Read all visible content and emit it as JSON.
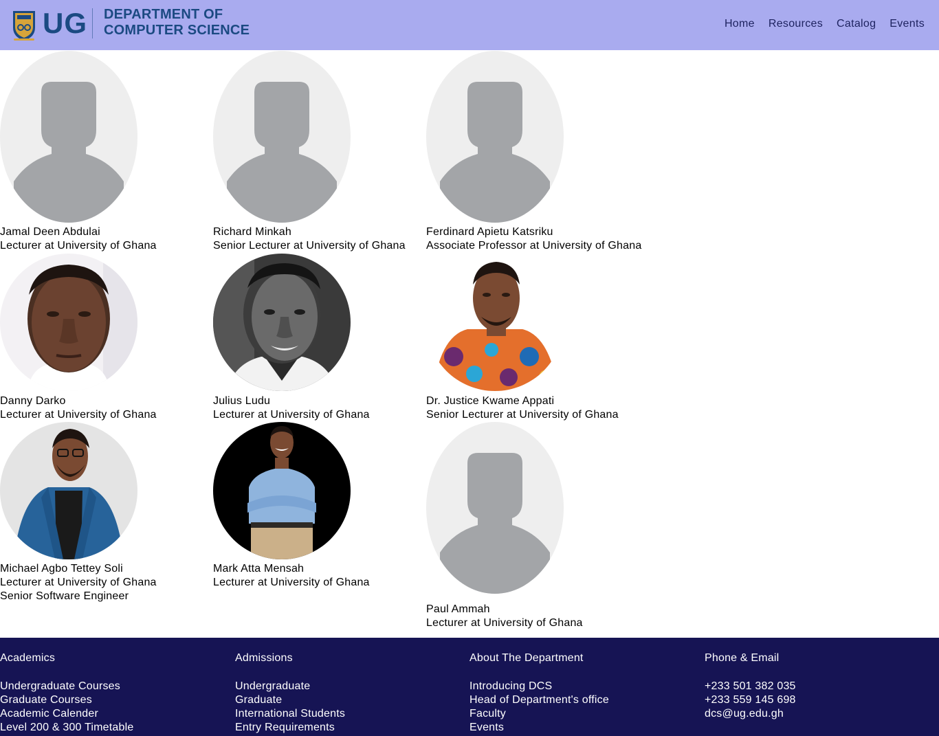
{
  "header": {
    "logo_text": "UG",
    "dept_line1": "DEPARTMENT OF",
    "dept_line2": "COMPUTER SCIENCE",
    "nav": [
      "Home",
      "Resources",
      "Catalog",
      "Events"
    ]
  },
  "faculty": [
    {
      "name": "Jamal Deen Abdulai",
      "role": "Lecturer at University of Ghana",
      "photo": "placeholder-avatar"
    },
    {
      "name": "Richard Minkah",
      "role": "Senior Lecturer at University of Ghana",
      "photo": "placeholder-avatar"
    },
    {
      "name": "Ferdinard Apietu Katsriku",
      "role": "Associate Professor at University of Ghana",
      "photo": "placeholder-avatar"
    },
    {
      "name": "Danny Darko",
      "role": "Lecturer at University of Ghana",
      "photo": "portrait-photo"
    },
    {
      "name": "Julius Ludu",
      "role": "Lecturer at University of Ghana",
      "photo": "portrait-photo-bw"
    },
    {
      "name": "Dr. Justice Kwame Appati",
      "role": "Senior Lecturer at University of Ghana",
      "photo": "portrait-photo"
    },
    {
      "name": "Michael Agbo Tettey Soli",
      "role": "Lecturer at University of Ghana",
      "role2": "Senior Software Engineer",
      "photo": "portrait-photo"
    },
    {
      "name": "Mark Atta Mensah",
      "role": "Lecturer at University of Ghana",
      "photo": "portrait-photo"
    },
    {
      "name": "Paul Ammah",
      "role": "Lecturer at University of Ghana",
      "photo": "placeholder-avatar"
    }
  ],
  "footer": {
    "academics": {
      "title": "Academics",
      "links": [
        "Undergraduate Courses",
        "Graduate Courses",
        "Academic Calender",
        "Level 200 & 300 Timetable"
      ]
    },
    "admissions": {
      "title": "Admissions",
      "links": [
        "Undergraduate",
        "Graduate",
        "International Students",
        "Entry Requirements"
      ]
    },
    "about": {
      "title": "About The Department",
      "links": [
        "Introducing DCS",
        "Head of Department's office",
        "Faculty",
        "Events"
      ]
    },
    "contact": {
      "title": "Phone & Email",
      "lines": [
        "+233 501 382 035",
        "+233 559 145 698",
        "dcs@ug.edu.gh"
      ]
    }
  },
  "colors": {
    "header_bg": "#a9abef",
    "footer_bg": "#161454",
    "logo_blue": "#1b4a82"
  }
}
